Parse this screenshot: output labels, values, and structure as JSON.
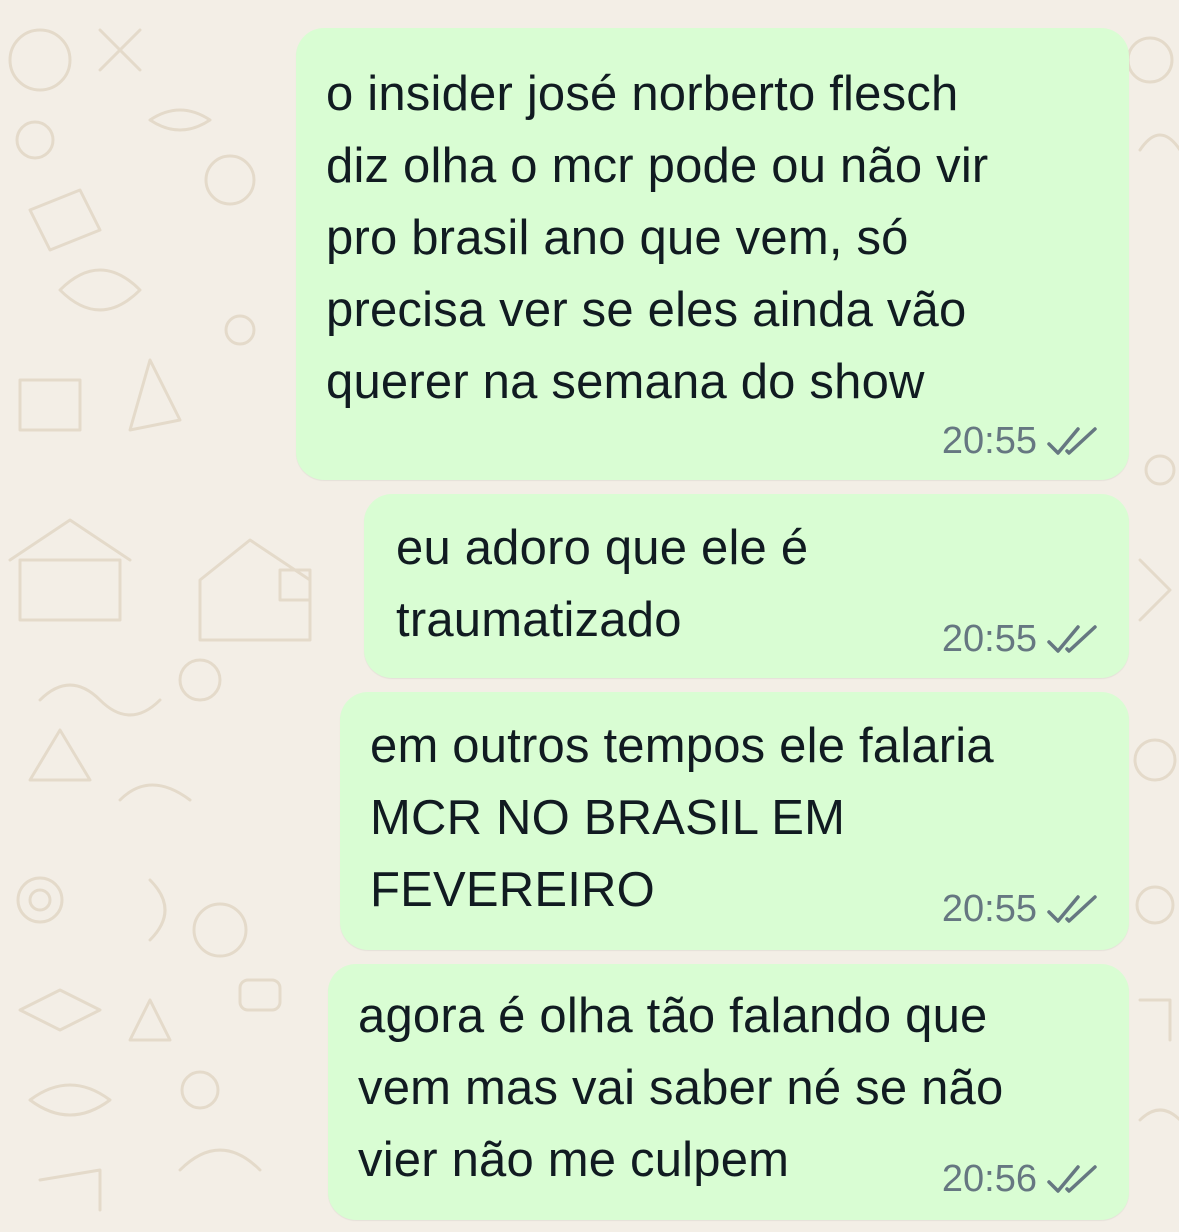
{
  "colors": {
    "wallpaper": "#f3eee6",
    "outgoing_bubble": "#d9fdd3",
    "message_text": "#111b21",
    "meta_text": "#667781"
  },
  "messages": [
    {
      "text": "o insider josé norberto flesch\ndiz olha o mcr pode ou não vir\npro brasil ano que vem, só\nprecisa ver se eles ainda vão\nquerer na semana do show",
      "time": "20:55",
      "status_icon": "double-check-icon"
    },
    {
      "text": "eu adoro que ele é\ntraumatizado",
      "time": "20:55",
      "status_icon": "double-check-icon"
    },
    {
      "text": "em outros tempos ele falaria\nMCR NO BRASIL EM\nFEVEREIRO",
      "time": "20:55",
      "status_icon": "double-check-icon"
    },
    {
      "text": "agora é olha tão falando que\nvem mas vai saber né se não\nvier não me culpem",
      "time": "20:56",
      "status_icon": "double-check-icon"
    }
  ]
}
